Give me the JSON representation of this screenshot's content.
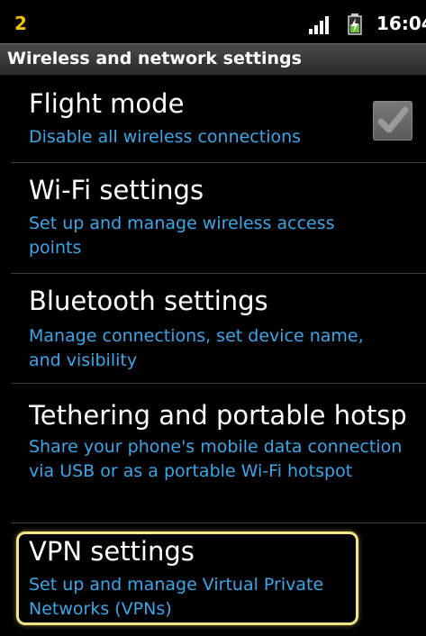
{
  "status_bar": {
    "notification_count": "2",
    "signal_icon": "signal-bars-icon",
    "battery_icon": "battery-charging-icon",
    "time": "16:04"
  },
  "header": {
    "title": "Wireless and network settings"
  },
  "settings": [
    {
      "title": "Flight mode",
      "summary": "Disable all wireless connections"
    },
    {
      "title": "Wi-Fi settings",
      "summary": "Set up and manage wireless access points"
    },
    {
      "title": "Bluetooth settings",
      "summary": "Manage connections, set device name, and visibility"
    },
    {
      "title": "Tethering and portable hotsp",
      "summary": "Share your phone's mobile data connection via USB or as a portable Wi-Fi hotspot"
    },
    {
      "title": "VPN settings",
      "summary": "Set up and manage Virtual Private Networks (VPNs)"
    }
  ],
  "colors": {
    "summary_text": "#3ea6e6",
    "highlight_border": "#f4e48a",
    "notification": "#f2c200"
  }
}
